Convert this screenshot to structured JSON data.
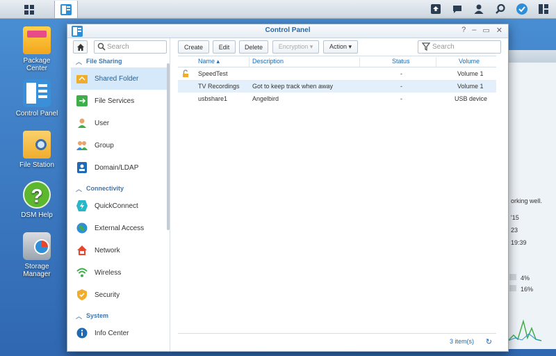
{
  "desktop": {
    "icons": [
      {
        "label": "Package Center"
      },
      {
        "label": "Control Panel"
      },
      {
        "label": "File Station"
      },
      {
        "label": "DSM Help"
      },
      {
        "label": "Storage Manager"
      }
    ]
  },
  "widget": {
    "lines": [
      "orking well.",
      "'15",
      "23",
      "19:39",
      "4%",
      "16%"
    ]
  },
  "window": {
    "title": "Control Panel"
  },
  "sidebar": {
    "search_placeholder": "Search",
    "sections": [
      {
        "label": "File Sharing"
      },
      {
        "label": "Connectivity"
      },
      {
        "label": "System"
      }
    ],
    "items": [
      {
        "label": "Shared Folder"
      },
      {
        "label": "File Services"
      },
      {
        "label": "User"
      },
      {
        "label": "Group"
      },
      {
        "label": "Domain/LDAP"
      },
      {
        "label": "QuickConnect"
      },
      {
        "label": "External Access"
      },
      {
        "label": "Network"
      },
      {
        "label": "Wireless"
      },
      {
        "label": "Security"
      },
      {
        "label": "Info Center"
      }
    ]
  },
  "toolbar": {
    "create": "Create",
    "edit": "Edit",
    "delete": "Delete",
    "encryption": "Encryption ▾",
    "action": "Action ▾",
    "search_placeholder": "Search"
  },
  "table": {
    "headers": [
      "Name ▴",
      "Description",
      "Status",
      "Volume"
    ],
    "rows": [
      {
        "name": "SpeedTest",
        "description": "",
        "status": "-",
        "volume": "Volume 1"
      },
      {
        "name": "TV Recordings",
        "description": "Got to keep track when away",
        "status": "-",
        "volume": "Volume 1"
      },
      {
        "name": "usbshare1",
        "description": "Angelbird",
        "status": "-",
        "volume": "USB device"
      }
    ],
    "count": "3 item(s)"
  }
}
